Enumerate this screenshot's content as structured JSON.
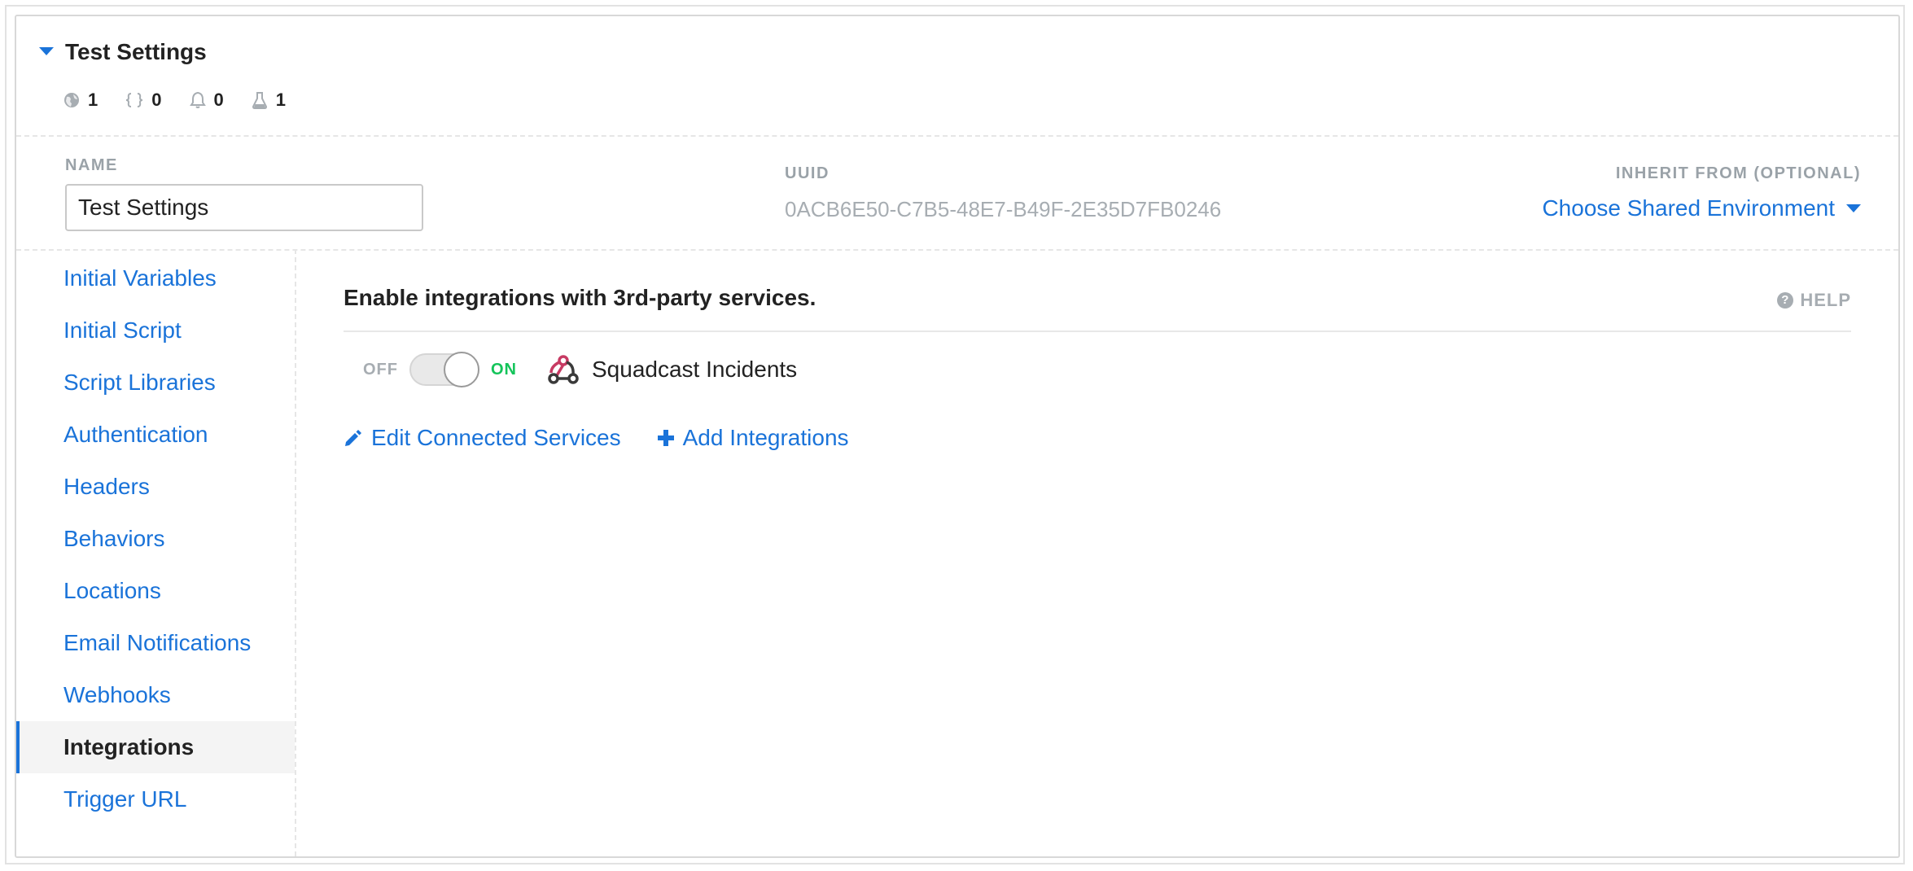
{
  "panel": {
    "title": "Test Settings",
    "stats": [
      {
        "icon": "globe-icon",
        "count": "1"
      },
      {
        "icon": "braces-icon",
        "count": "0"
      },
      {
        "icon": "bell-icon",
        "count": "0"
      },
      {
        "icon": "flask-icon",
        "count": "1"
      }
    ]
  },
  "fields": {
    "name_label": "NAME",
    "name_value": "Test Settings",
    "uuid_label": "UUID",
    "uuid_value": "0ACB6E50-C7B5-48E7-B49F-2E35D7FB0246",
    "inherit_label": "INHERIT FROM (OPTIONAL)",
    "inherit_value": "Choose Shared Environment"
  },
  "sidebar": {
    "items": [
      {
        "label": "Initial Variables",
        "active": false
      },
      {
        "label": "Initial Script",
        "active": false
      },
      {
        "label": "Script Libraries",
        "active": false
      },
      {
        "label": "Authentication",
        "active": false
      },
      {
        "label": "Headers",
        "active": false
      },
      {
        "label": "Behaviors",
        "active": false
      },
      {
        "label": "Locations",
        "active": false
      },
      {
        "label": "Email Notifications",
        "active": false
      },
      {
        "label": "Webhooks",
        "active": false
      },
      {
        "label": "Integrations",
        "active": true
      },
      {
        "label": "Trigger URL",
        "active": false
      }
    ]
  },
  "main": {
    "heading": "Enable integrations with 3rd-party services.",
    "help_label": "HELP",
    "integration": {
      "off_label": "OFF",
      "on_label": "ON",
      "enabled": true,
      "name": "Squadcast Incidents",
      "icon": "webhook-icon"
    },
    "actions": {
      "edit_label": "Edit Connected Services",
      "add_label": "Add Integrations"
    }
  },
  "colors": {
    "accent": "#1a73d9",
    "on": "#14c45a",
    "muted": "#a7adb2",
    "webhook": "#c73a63"
  }
}
